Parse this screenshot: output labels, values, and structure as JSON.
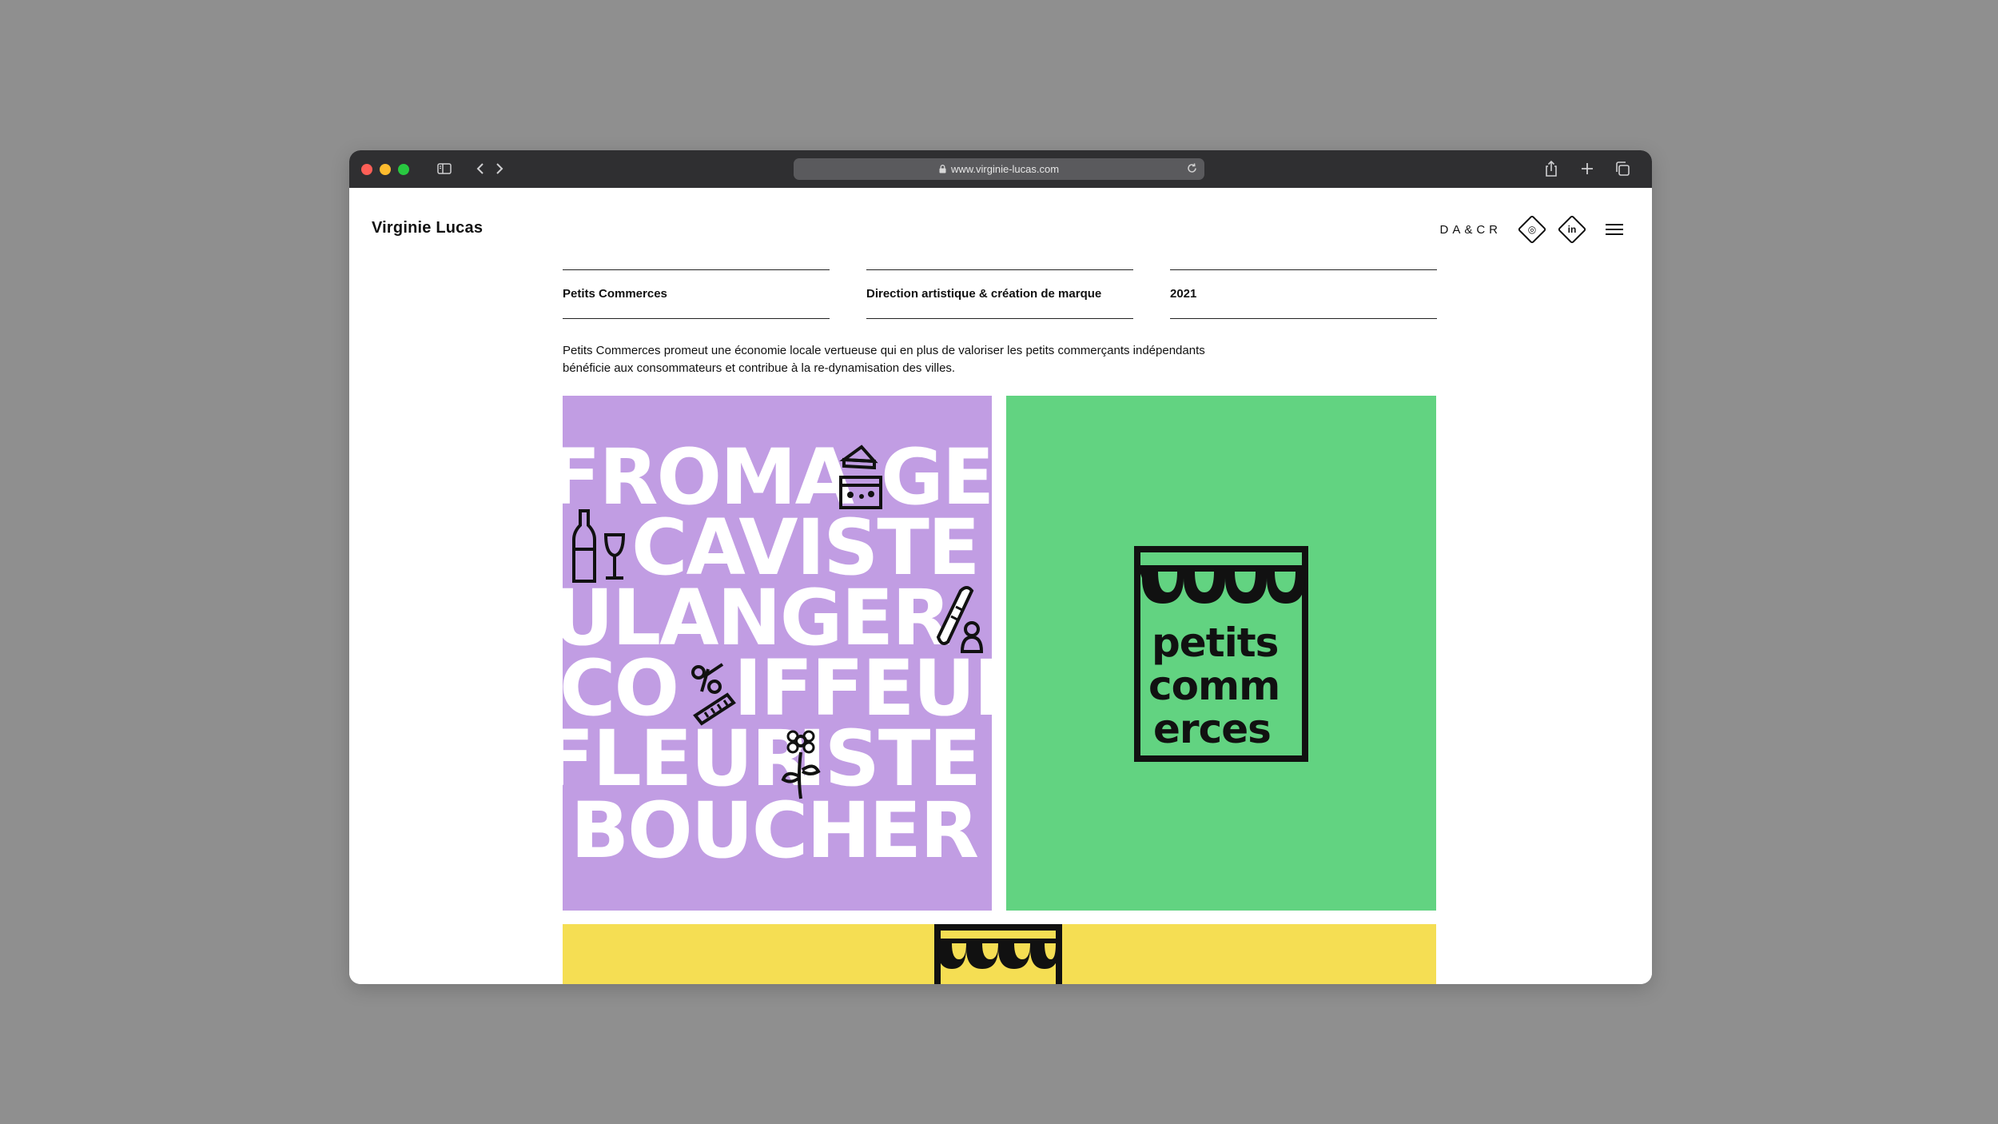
{
  "browser": {
    "url": "www.virginie-lucas.com"
  },
  "site": {
    "brand": "Virginie Lucas",
    "nav_label": "DA&CR",
    "instagram_glyph": "◎",
    "linkedin_glyph": "in"
  },
  "project": {
    "name": "Petits Commerces",
    "discipline": "Direction artistique & création de marque",
    "year": "2021",
    "description_line1": "Petits Commerces promeut une économie locale vertueuse qui en plus de valoriser les petits commerçants indépendants",
    "description_line2": "bénéficie aux consommateurs et contribue à la re-dynamisation des villes."
  },
  "artwork": {
    "words": [
      "FROMA",
      "GE",
      "CAVISTE",
      "ULANGER",
      "CO",
      "IFFEUR",
      "FLEUR",
      "ISTE",
      "BOUCHER"
    ],
    "logo_lines": [
      "petits",
      "comm",
      "erces"
    ]
  },
  "colors": {
    "purple": "#c19de3",
    "green": "#62d381",
    "yellow": "#f5de53"
  }
}
